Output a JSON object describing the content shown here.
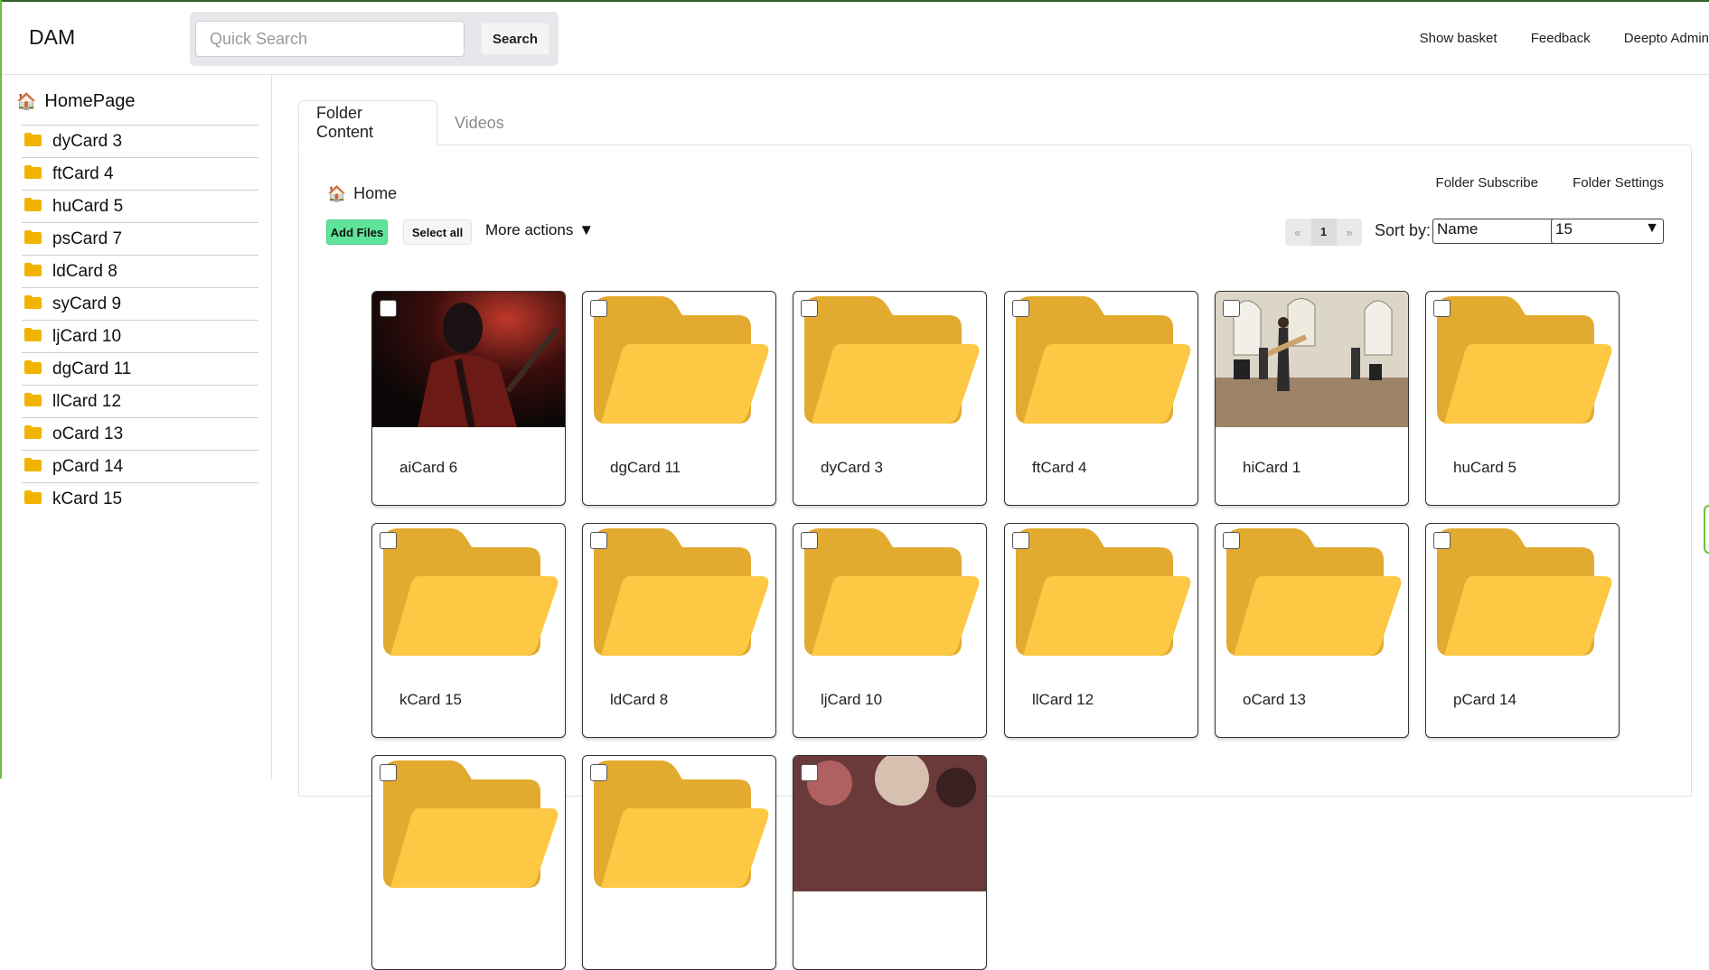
{
  "app": {
    "brand": "DAM"
  },
  "search": {
    "placeholder": "Quick Search",
    "button_label": "Search"
  },
  "top_nav": [
    "Show basket",
    "Feedback",
    "Deepto Admin"
  ],
  "sidebar": {
    "home_label": "HomePage",
    "items": [
      "dyCard 3",
      "ftCard 4",
      "huCard 5",
      "psCard 7",
      "ldCard 8",
      "syCard 9",
      "ljCard 10",
      "dgCard 11",
      "llCard 12",
      "oCard 13",
      "pCard 14",
      "kCard 15"
    ]
  },
  "tabs": {
    "active": "Folder Content",
    "inactive": "Videos"
  },
  "breadcrumb": {
    "home": "Home"
  },
  "folder_actions": {
    "subscribe": "Folder Subscribe",
    "settings": "Folder Settings"
  },
  "toolbar": {
    "add_files": "Add Files",
    "select_all": "Select all",
    "more_actions": "More actions"
  },
  "pager": {
    "prev": "«",
    "current": "1",
    "next": "»"
  },
  "sort": {
    "label": "Sort by:",
    "field": "Name",
    "page_size": "15"
  },
  "cards": [
    {
      "label": "aiCard 6",
      "type": "photo-dark"
    },
    {
      "label": "dgCard 11",
      "type": "folder"
    },
    {
      "label": "dyCard 3",
      "type": "folder"
    },
    {
      "label": "ftCard 4",
      "type": "folder"
    },
    {
      "label": "hiCard 1",
      "type": "photo-hall"
    },
    {
      "label": "huCard 5",
      "type": "folder"
    },
    {
      "label": "kCard 15",
      "type": "folder"
    },
    {
      "label": "ldCard 8",
      "type": "folder"
    },
    {
      "label": "ljCard 10",
      "type": "folder"
    },
    {
      "label": "llCard 12",
      "type": "folder"
    },
    {
      "label": "oCard 13",
      "type": "folder"
    },
    {
      "label": "pCard 14",
      "type": "folder"
    },
    {
      "label": "",
      "type": "folder"
    },
    {
      "label": "",
      "type": "folder"
    },
    {
      "label": "",
      "type": "photo-crowd"
    }
  ],
  "colors": {
    "accent_green": "#5fe39a",
    "folder_dark": "#e2ab2f",
    "folder_light": "#fdc843",
    "sidebar_folder": "#f0b400"
  }
}
